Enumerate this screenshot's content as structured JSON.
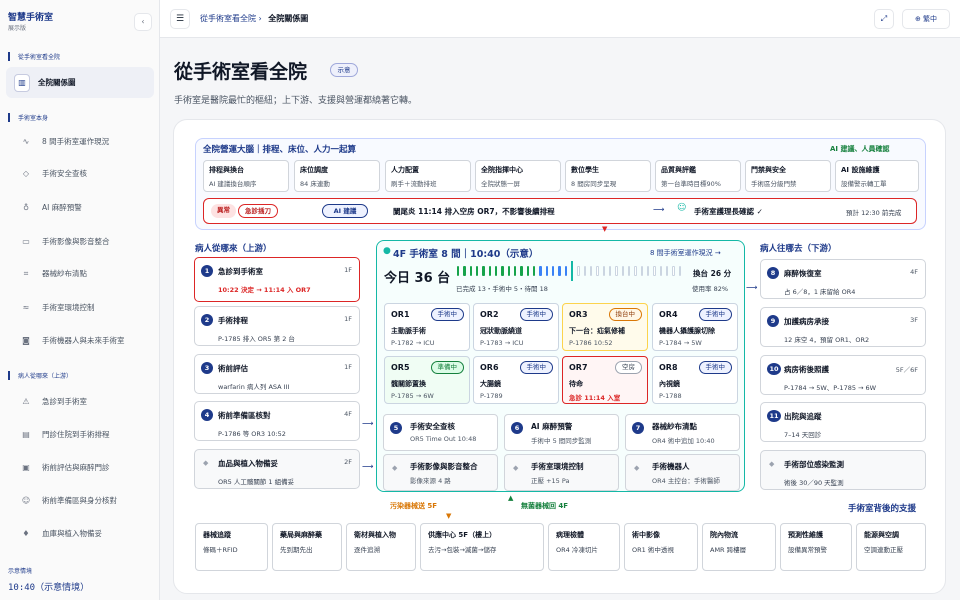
{
  "app": {
    "title": "智慧手術室",
    "subtitle": "展示版"
  },
  "sidebar": {
    "section1": "從手術室看全院",
    "active": "全院關係圖",
    "section2": "手術室本身",
    "items2": [
      "8 間手術室運作現況",
      "手術安全查核",
      "AI 麻醉預警",
      "手術影像與影音整合",
      "器械紗布清點",
      "手術室環境控制",
      "手術機器人與未來手術室"
    ],
    "section3": "病人從哪來（上游）",
    "items3": [
      "急診到手術室",
      "門診住院到手術排程",
      "術前評估與麻醉門診",
      "術前準備區與身分核對",
      "血庫與植入物備妥"
    ],
    "footer_label": "示意情境",
    "footer_value": "10:40（示意情境）",
    "collapse": "‹"
  },
  "topbar": {
    "breadcrumb": "從手術室看全院",
    "current": "全院關係圖",
    "lang": "繁中",
    "menu_icon": "☰",
    "expand_icon": "⤢"
  },
  "page": {
    "title": "從手術室看全院",
    "tag": "示意",
    "lead": "手術室是醫院最忙的樞紐；上下游、支援與營運都繞著它轉。"
  },
  "ops": {
    "title": "全院營運大腦｜排程、床位、人力一起算",
    "right": "AI 建議、人員確認",
    "cells": [
      {
        "t": "排程與換台",
        "s": "AI 建議換台順序"
      },
      {
        "t": "床位調度",
        "s": "84 床連動"
      },
      {
        "t": "人力配置",
        "s": "刷手＋流動排班"
      },
      {
        "t": "全院指揮中心",
        "s": "全院狀態一屏"
      },
      {
        "t": "數位學生",
        "s": "8 間房同步呈現"
      },
      {
        "t": "品質與評鑑",
        "s": "第一台準時目標90%"
      },
      {
        "t": "門禁與安全",
        "s": "手術區分級門禁"
      },
      {
        "t": "AI 設施維護",
        "s": "設備警示轉工單"
      }
    ],
    "alert": {
      "tag1": "異常",
      "tag2": "急診插刀",
      "ai": "AI 建議",
      "text": "闌尾炎 11:14 排入空房 OR7，不影響後續排程",
      "confirm": "手術室護理長確認 ✓",
      "eta": "預計 12:30 前完成"
    }
  },
  "upstream": {
    "title": "病人從哪來（上游）",
    "items": [
      {
        "n": "1",
        "t": "急診到手術室",
        "f": "1F",
        "s": "10:22 決定 → 11:14 入 OR7"
      },
      {
        "n": "2",
        "t": "手術排程",
        "f": "1F",
        "s": "P-1785 排入 OR5 第 2 台"
      },
      {
        "n": "3",
        "t": "術前評估",
        "f": "1F",
        "s": "warfarin 病人列 ASA III"
      },
      {
        "n": "4",
        "t": "術前準備區核對",
        "f": "4F",
        "s": "P-1786 等 OR3 10:52"
      },
      {
        "n": "◆",
        "t": "血品與植入物備妥",
        "f": "2F",
        "s": "OR5 人工髖關節 1 組備妥"
      }
    ]
  },
  "downstream": {
    "title": "病人往哪去（下游）",
    "items": [
      {
        "n": "8",
        "t": "麻醉恢復室",
        "f": "4F",
        "s": "占 6／8，1 床留給 OR4"
      },
      {
        "n": "9",
        "t": "加護病房承接",
        "f": "3F",
        "s": "12 床空 4，預留 OR1、OR2"
      },
      {
        "n": "10",
        "t": "病房術後照護",
        "f": "5F／6F",
        "s": "P-1784 → 5W、P-1785 → 6W"
      },
      {
        "n": "11",
        "t": "出院與追蹤",
        "f": "",
        "s": "7–14 天回診"
      },
      {
        "n": "◆",
        "t": "手術部位感染監測",
        "f": "",
        "s": "術後 30／90 天監測"
      }
    ]
  },
  "hub": {
    "title": "4F 手術室 8 間｜10:40（示意）",
    "link": "8 間手術室運作現況 →",
    "today": "今日 36 台",
    "today_sub": "已完成 13・手術中 5・待開 18",
    "swap": "換台 26 分",
    "usage": "使用率 82%",
    "progress": {
      "done": 13,
      "active": 5,
      "pending": 18
    },
    "rooms": [
      {
        "n": "OR1",
        "st": "手術中",
        "l1": "主動脈手術",
        "l2": "P-1782 → ICU",
        "kind": "run"
      },
      {
        "n": "OR2",
        "st": "手術中",
        "l1": "冠狀動脈繞道",
        "l2": "P-1783 → ICU",
        "kind": "run"
      },
      {
        "n": "OR3",
        "st": "換台中",
        "l1": "下一台：疝氣修補",
        "l2": "P-1786 10:52",
        "kind": "swap"
      },
      {
        "n": "OR4",
        "st": "手術中",
        "l1": "機器人攝護腺切除",
        "l2": "P-1784 → 5W",
        "kind": "run"
      },
      {
        "n": "OR5",
        "st": "準備中",
        "l1": "髖關節置換",
        "l2": "P-1785 → 6W",
        "kind": "prep"
      },
      {
        "n": "OR6",
        "st": "手術中",
        "l1": "大腸鏡",
        "l2": "P-1789",
        "kind": "run"
      },
      {
        "n": "OR7",
        "st": "空房",
        "l1": "待命",
        "l2": "急診 11:14 入室",
        "kind": "empty"
      },
      {
        "n": "OR8",
        "st": "手術中",
        "l1": "內視鏡",
        "l2": "P-1788",
        "kind": "run"
      }
    ],
    "subs": [
      {
        "n": "5",
        "t": "手術安全查核",
        "s": "OR5 Time Out 10:48"
      },
      {
        "n": "6",
        "t": "AI 麻醉預警",
        "s": "手術中 5 間同步監測"
      },
      {
        "n": "7",
        "t": "器械紗布清點",
        "s": "OR4 術中追加 10:40"
      },
      {
        "n": "◆",
        "t": "手術影像與影音整合",
        "s": "影像來源 4 路"
      },
      {
        "n": "◆",
        "t": "手術室環境控制",
        "s": "正壓 +15 Pa"
      },
      {
        "n": "◆",
        "t": "手術機器人",
        "s": "OR4 主控台：手術醫師"
      }
    ]
  },
  "flows": {
    "dirty": "污染器械送 5F",
    "clean": "無菌器械回 4F"
  },
  "support": {
    "title": "手術室背後的支援",
    "items": [
      {
        "t": "器械追蹤",
        "s": "條碼＋RFID"
      },
      {
        "t": "藥局與麻醉藥",
        "s": "先到期先出"
      },
      {
        "t": "衛材與植入物",
        "s": "逐件追溯"
      },
      {
        "t": "供應中心 5F（樓上）",
        "s": "去污→包裝→滅菌→儲存"
      },
      {
        "t": "病理檢體",
        "s": "OR4 冷凍切片"
      },
      {
        "t": "術中影像",
        "s": "OR1 術中透視"
      },
      {
        "t": "院內物流",
        "s": "AMR 跨樓層"
      },
      {
        "t": "預測性維護",
        "s": "設備異常預警"
      },
      {
        "t": "能源與空調",
        "s": "空調連動正壓"
      }
    ]
  },
  "colors": {
    "navy": "#1e3a8a",
    "teal": "#14b8a6",
    "red": "#dc2626",
    "green": "#15803d",
    "amber": "#d97706"
  }
}
